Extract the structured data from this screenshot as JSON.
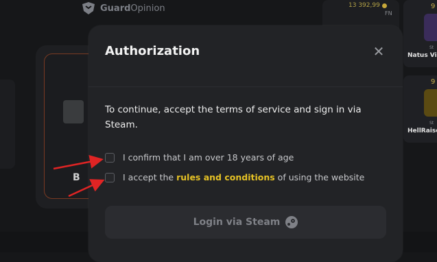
{
  "background": {
    "logo": {
      "name_bold": "Guard",
      "name_light": "Opinion"
    },
    "price": "13 392,99",
    "wear": "FN",
    "left_card_letter": "B",
    "right_cards": [
      {
        "number": "9",
        "team": "Natus Vi",
        "small": "St"
      },
      {
        "number": "9",
        "team": "HellRaise",
        "small": "St"
      }
    ]
  },
  "modal": {
    "title": "Authorization",
    "close_icon": "close-icon",
    "intro": "To continue, accept the terms of service and sign in via Steam.",
    "checkbox_age": "I confirm that I am over 18 years of age",
    "checkbox_rules_prefix": "I accept the",
    "checkbox_rules_link": "rules and conditions",
    "checkbox_rules_suffix": "of using the website",
    "login_button": "Login via Steam",
    "login_icon": "steam-icon"
  },
  "colors": {
    "accent_link": "#e6c225",
    "modal_bg": "#222326",
    "annotation_arrow": "#e02424"
  }
}
